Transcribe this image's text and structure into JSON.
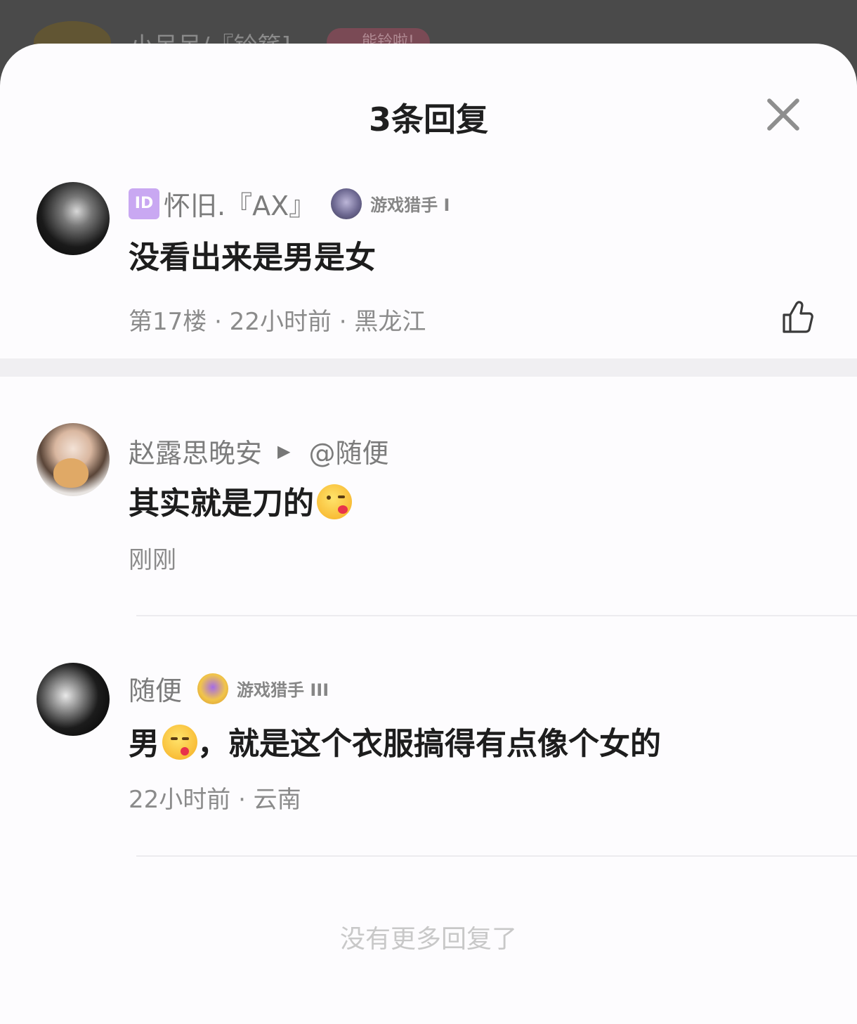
{
  "background": {
    "name": "小呆呆/『铃筵]",
    "badge": "能铃啦!"
  },
  "sheet": {
    "title": "3条回复",
    "close_icon": "close-icon"
  },
  "replies": [
    {
      "id_badge": "ID",
      "username": "怀旧.『AX』",
      "level": "游戏猎手 I",
      "comment": "没看出来是男是女",
      "meta": "第17楼 · 22小时前 · 黑龙江",
      "like_icon": "thumbs-up-icon"
    },
    {
      "username": "赵露思晚安",
      "reply_to": "@随便",
      "comment": "其实就是刀的",
      "emoji": "kissing-face-emoji",
      "meta": "刚刚"
    },
    {
      "username": "随便",
      "level": "游戏猎手 III",
      "comment_prefix": "男",
      "emoji": "yum-face-emoji",
      "comment_suffix": "，就是这个衣服搞得有点像个女的",
      "meta": "22小时前 · 云南"
    }
  ],
  "footer": {
    "text": "没有更多回复了"
  },
  "colors": {
    "overlay": "#4a4a4a",
    "sheet": "#fdfcfe",
    "text_primary": "#1d1d1d",
    "text_secondary": "#7c7c7c",
    "id_badge": "#c9a8f2"
  }
}
